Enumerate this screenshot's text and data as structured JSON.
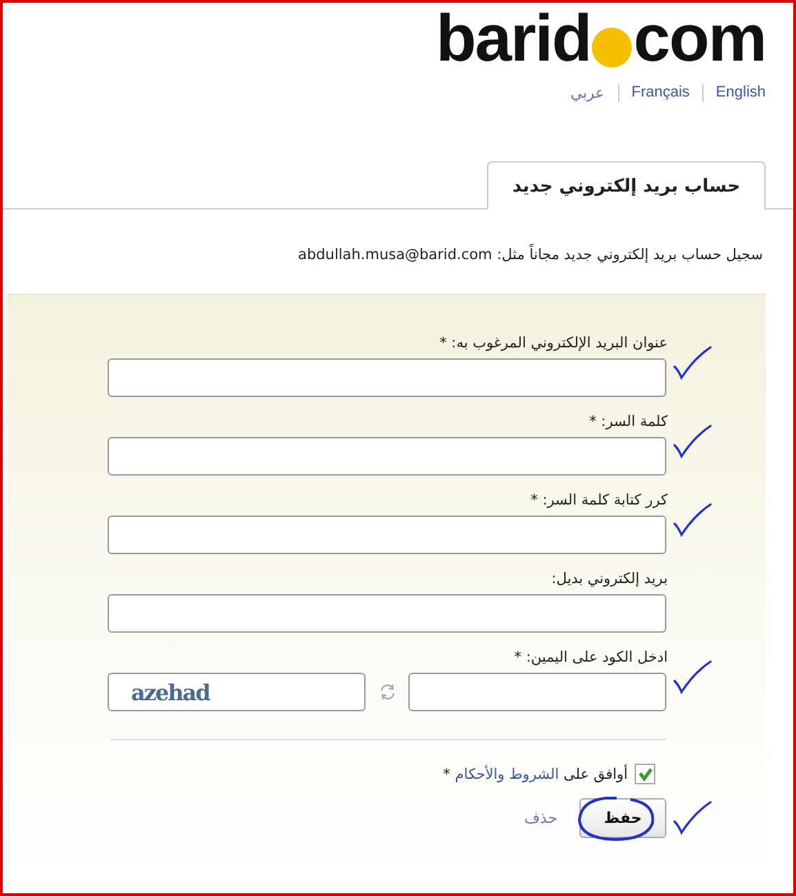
{
  "logo": {
    "name": "barid",
    "suffix": "com"
  },
  "languages": [
    {
      "label": "English",
      "selected": false
    },
    {
      "label": "Français",
      "selected": false
    },
    {
      "label": "عربي",
      "selected": true
    }
  ],
  "tabs": [
    {
      "label": "حساب بريد إلكتروني جديد",
      "selected": true
    }
  ],
  "intro": "سجيل حساب بريد إلكتروني جديد مجاناً مثل: abdullah.musa@barid.com",
  "fields": [
    {
      "kind": "text",
      "label": "عنوان البريد الإلكتروني المرغوب به: *",
      "hand_checked": true
    },
    {
      "kind": "password",
      "label": "كلمة السر: *",
      "hand_checked": true
    },
    {
      "kind": "password",
      "label": "كرر كتابة كلمة السر: *",
      "hand_checked": true
    },
    {
      "kind": "text",
      "label": "بريد إلكتروني بديل:",
      "hand_checked": false
    },
    {
      "kind": "captcha",
      "label": "ادخل الكود على اليمين: *",
      "captcha": "azehad",
      "hand_checked": true
    }
  ],
  "terms": {
    "checked": true,
    "prefix": "أوافق على",
    "link": "الشروط والأحكام",
    "suffix": "*"
  },
  "actions": {
    "save": {
      "label": "حفظ",
      "circled": true,
      "hand_checked": true
    },
    "delete": "حذف"
  }
}
